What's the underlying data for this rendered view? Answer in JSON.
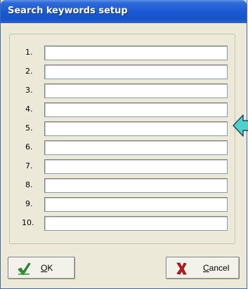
{
  "window": {
    "title": "Search keywords setup"
  },
  "keywords": [
    {
      "number": "1.",
      "value": ""
    },
    {
      "number": "2.",
      "value": ""
    },
    {
      "number": "3.",
      "value": ""
    },
    {
      "number": "4.",
      "value": ""
    },
    {
      "number": "5.",
      "value": ""
    },
    {
      "number": "6.",
      "value": ""
    },
    {
      "number": "7.",
      "value": ""
    },
    {
      "number": "8.",
      "value": ""
    },
    {
      "number": "9.",
      "value": ""
    },
    {
      "number": "10.",
      "value": ""
    }
  ],
  "buttons": {
    "ok": {
      "label_u": "O",
      "label_rest": "K",
      "icon": "checkmark-icon"
    },
    "cancel": {
      "label_u": "C",
      "label_rest": "ancel",
      "icon": "cross-icon"
    }
  },
  "colors": {
    "title_bar": "#1c59d4",
    "window_bg": "#ece9d8",
    "arrow": "#4fd0cc"
  }
}
